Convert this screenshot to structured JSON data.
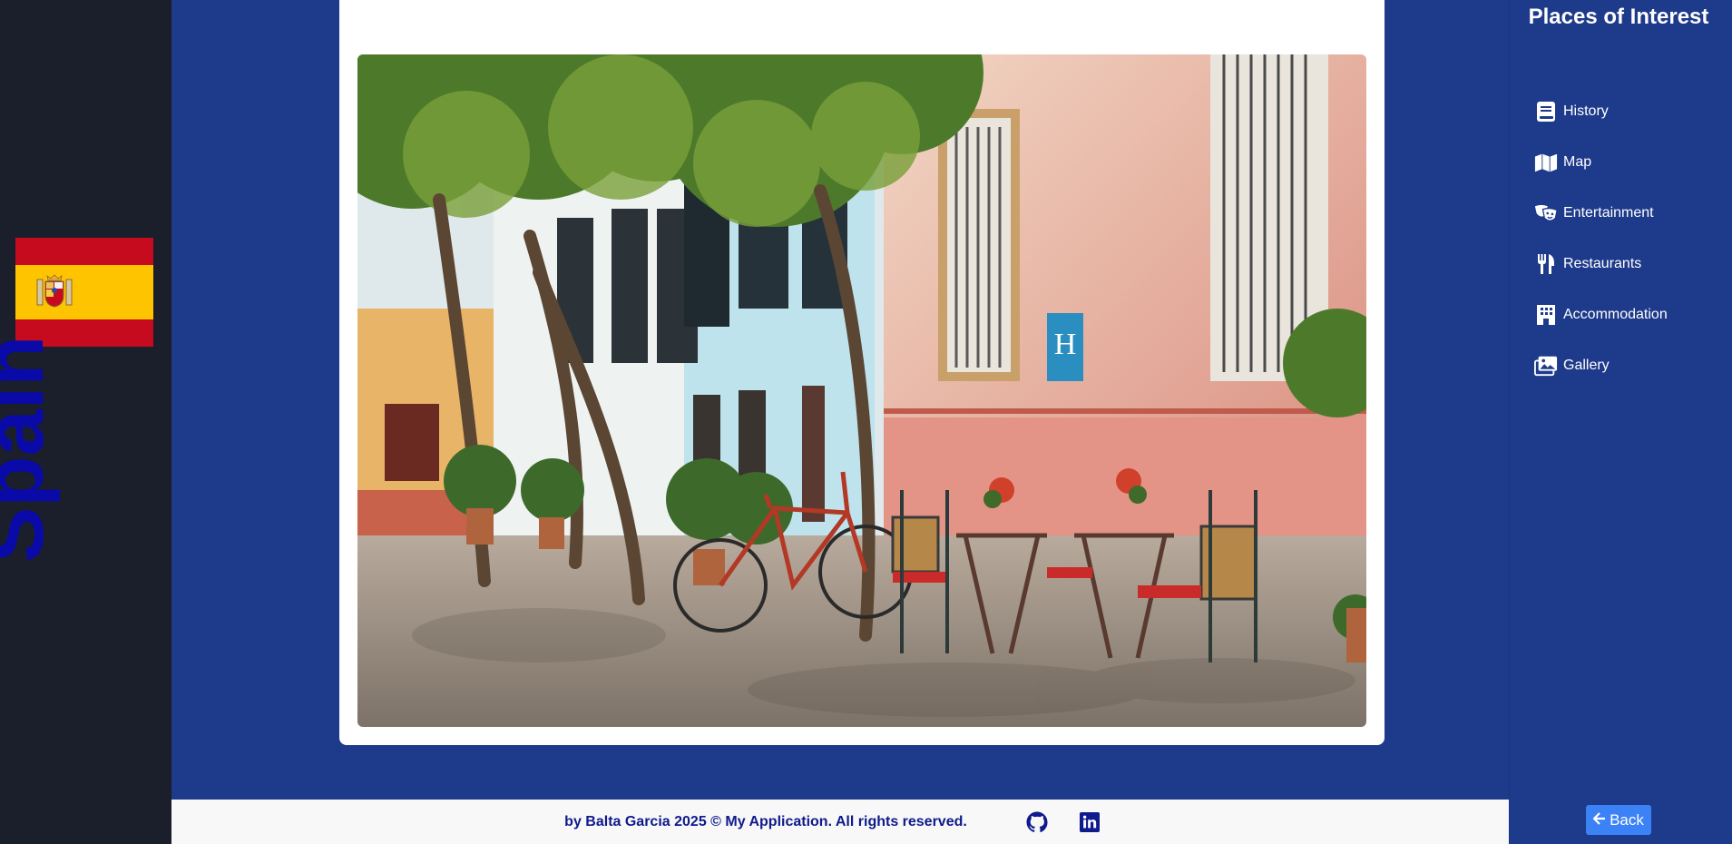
{
  "country": {
    "name": "Spain",
    "flag_colors": {
      "red": "#c60b1e",
      "yellow": "#ffc400"
    }
  },
  "sidebar": {
    "title": "Places of Interest",
    "items": [
      {
        "label": "History",
        "icon": "book-icon"
      },
      {
        "label": "Map",
        "icon": "map-icon"
      },
      {
        "label": "Entertainment",
        "icon": "theater-masks-icon"
      },
      {
        "label": "Restaurants",
        "icon": "utensils-icon"
      },
      {
        "label": "Accommodation",
        "icon": "hotel-icon"
      },
      {
        "label": "Gallery",
        "icon": "images-icon"
      }
    ],
    "back_label": "Back"
  },
  "footer": {
    "text": "by Balta Garcia 2025 © My Application. All rights reserved.",
    "links": [
      {
        "icon": "github-icon"
      },
      {
        "icon": "linkedin-icon"
      }
    ]
  },
  "colors": {
    "accent": "#1e3a8a",
    "sidebar_dark": "#1a1f2b",
    "button": "#3b82f6",
    "country_text": "#0a0aa8"
  }
}
